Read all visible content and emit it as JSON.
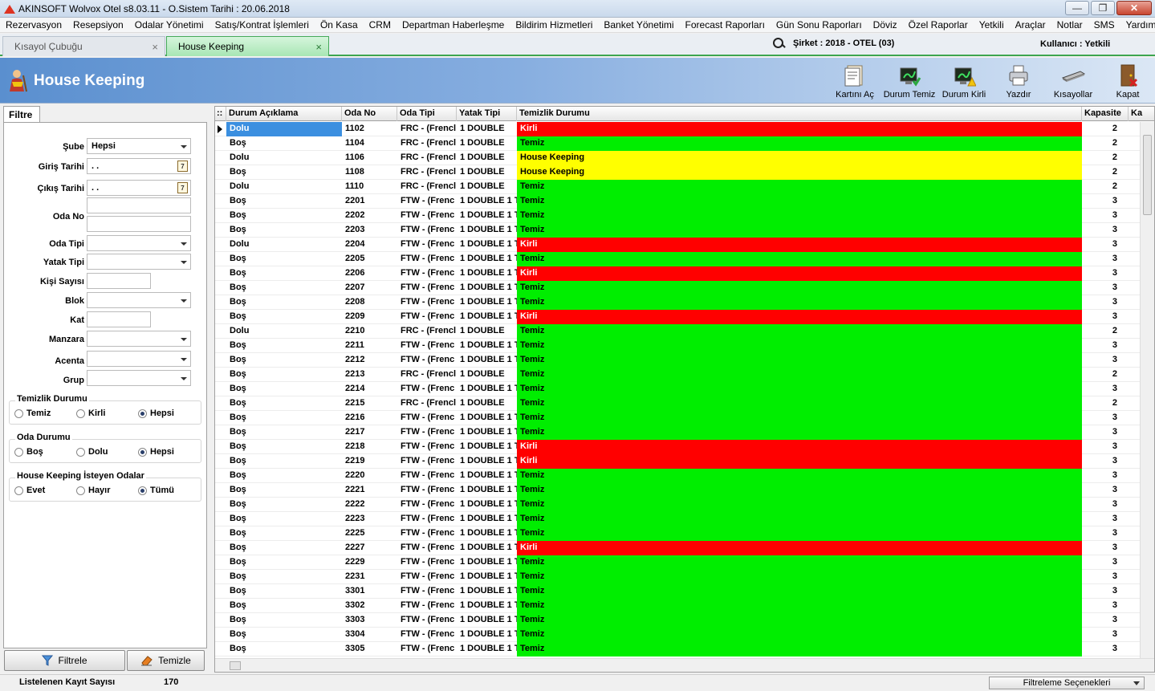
{
  "window": {
    "title": "AKINSOFT Wolvox Otel s8.03.11 - O.Sistem Tarihi : 20.06.2018",
    "minimize": "—",
    "restore": "❐",
    "close": "✕"
  },
  "menu": [
    "Rezervasyon",
    "Resepsiyon",
    "Odalar Yönetimi",
    "Satış/Kontrat İşlemleri",
    "Ön Kasa",
    "CRM",
    "Departman Haberleşme",
    "Bildirim Hizmetleri",
    "Banket Yönetimi",
    "Forecast Raporları",
    "Gün Sonu Raporları",
    "Döviz",
    "Özel Raporlar",
    "Yetkili",
    "Araçlar",
    "Notlar",
    "SMS",
    "Yardım"
  ],
  "tabs": [
    {
      "label": "Kısayol Çubuğu",
      "close": "×"
    },
    {
      "label": "House Keeping",
      "close": "×"
    }
  ],
  "company": "Şirket : 2018 - OTEL (03)",
  "user": "Kullanıcı : Yetkili",
  "header": {
    "title": "House Keeping"
  },
  "toolbar": [
    {
      "label": "Kartını Aç",
      "icon": "card-open-icon"
    },
    {
      "label": "Durum Temiz",
      "icon": "status-clean-icon"
    },
    {
      "label": "Durum Kirli",
      "icon": "status-dirty-icon"
    },
    {
      "label": "Yazdır",
      "icon": "printer-icon"
    },
    {
      "label": "Kısayollar",
      "icon": "shortcuts-icon"
    },
    {
      "label": "Kapat",
      "icon": "exit-door-icon"
    }
  ],
  "filter": {
    "tab": "Filtre",
    "sube_label": "Şube",
    "sube_value": "Hepsi",
    "giris_label": "Giriş Tarihi",
    "giris_value": ". .",
    "cikis_label": "Çıkış Tarihi",
    "cikis_value": ". .",
    "calendar_glyph": "7",
    "odano_label": "Oda No",
    "odatipi_label": "Oda Tipi",
    "yatak_label": "Yatak Tipi",
    "kisi_label": "Kişi Sayısı",
    "blok_label": "Blok",
    "kat_label": "Kat",
    "manzara_label": "Manzara",
    "acenta_label": "Acenta",
    "grup_label": "Grup",
    "temizlik": {
      "title": "Temizlik Durumu",
      "options": [
        "Temiz",
        "Kirli",
        "Hepsi"
      ],
      "selected": 2
    },
    "oda": {
      "title": "Oda Durumu",
      "options": [
        "Boş",
        "Dolu",
        "Hepsi"
      ],
      "selected": 2
    },
    "hk": {
      "title": "House Keeping İsteyen Odalar",
      "options": [
        "Evet",
        "Hayır",
        "Tümü"
      ],
      "selected": 2
    },
    "filter_button": "Filtrele",
    "clear_button": "Temizle"
  },
  "grid": {
    "columns": [
      "Durum Açıklama",
      "Oda No",
      "Oda Tipi",
      "Yatak Tipi",
      "Temizlik Durumu",
      "Kapasite",
      "Ka"
    ],
    "corner": "::",
    "status_colors": {
      "Kirli": "#ff0000",
      "Temiz": "#00ee00",
      "House Keeping": "#ffff00"
    },
    "rows": [
      [
        "Dolu",
        "1102",
        "FRC - (Frencl",
        "1 DOUBLE",
        "Kirli",
        "2"
      ],
      [
        "Boş",
        "1104",
        "FRC - (Frencl",
        "1 DOUBLE",
        "Temiz",
        "2"
      ],
      [
        "Dolu",
        "1106",
        "FRC - (Frencl",
        "1 DOUBLE",
        "House Keeping",
        "2"
      ],
      [
        "Boş",
        "1108",
        "FRC - (Frencl",
        "1 DOUBLE",
        "House Keeping",
        "2"
      ],
      [
        "Dolu",
        "1110",
        "FRC - (Frencl",
        "1 DOUBLE",
        "Temiz",
        "2"
      ],
      [
        "Boş",
        "2201",
        "FTW - (Frenc",
        "1 DOUBLE 1 T",
        "Temiz",
        "3"
      ],
      [
        "Boş",
        "2202",
        "FTW - (Frenc",
        "1 DOUBLE 1 T",
        "Temiz",
        "3"
      ],
      [
        "Boş",
        "2203",
        "FTW - (Frenc",
        "1 DOUBLE 1 T",
        "Temiz",
        "3"
      ],
      [
        "Dolu",
        "2204",
        "FTW - (Frenc",
        "1 DOUBLE 1 T",
        "Kirli",
        "3"
      ],
      [
        "Boş",
        "2205",
        "FTW - (Frenc",
        "1 DOUBLE 1 T",
        "Temiz",
        "3"
      ],
      [
        "Boş",
        "2206",
        "FTW - (Frenc",
        "1 DOUBLE 1 T",
        "Kirli",
        "3"
      ],
      [
        "Boş",
        "2207",
        "FTW - (Frenc",
        "1 DOUBLE 1 T",
        "Temiz",
        "3"
      ],
      [
        "Boş",
        "2208",
        "FTW - (Frenc",
        "1 DOUBLE 1 T",
        "Temiz",
        "3"
      ],
      [
        "Boş",
        "2209",
        "FTW - (Frenc",
        "1 DOUBLE 1 T",
        "Kirli",
        "3"
      ],
      [
        "Dolu",
        "2210",
        "FRC - (Frencl",
        "1 DOUBLE",
        "Temiz",
        "2"
      ],
      [
        "Boş",
        "2211",
        "FTW - (Frenc",
        "1 DOUBLE 1 T",
        "Temiz",
        "3"
      ],
      [
        "Boş",
        "2212",
        "FTW - (Frenc",
        "1 DOUBLE 1 T",
        "Temiz",
        "3"
      ],
      [
        "Boş",
        "2213",
        "FRC - (Frencl",
        "1 DOUBLE",
        "Temiz",
        "2"
      ],
      [
        "Boş",
        "2214",
        "FTW - (Frenc",
        "1 DOUBLE 1 T",
        "Temiz",
        "3"
      ],
      [
        "Boş",
        "2215",
        "FRC - (Frencl",
        "1 DOUBLE",
        "Temiz",
        "2"
      ],
      [
        "Boş",
        "2216",
        "FTW - (Frenc",
        "1 DOUBLE 1 T",
        "Temiz",
        "3"
      ],
      [
        "Boş",
        "2217",
        "FTW - (Frenc",
        "1 DOUBLE 1 T",
        "Temiz",
        "3"
      ],
      [
        "Boş",
        "2218",
        "FTW - (Frenc",
        "1 DOUBLE 1 T",
        "Kirli",
        "3"
      ],
      [
        "Boş",
        "2219",
        "FTW - (Frenc",
        "1 DOUBLE 1 T",
        "Kirli",
        "3"
      ],
      [
        "Boş",
        "2220",
        "FTW - (Frenc",
        "1 DOUBLE 1 T",
        "Temiz",
        "3"
      ],
      [
        "Boş",
        "2221",
        "FTW - (Frenc",
        "1 DOUBLE 1 T",
        "Temiz",
        "3"
      ],
      [
        "Boş",
        "2222",
        "FTW - (Frenc",
        "1 DOUBLE 1 T",
        "Temiz",
        "3"
      ],
      [
        "Boş",
        "2223",
        "FTW - (Frenc",
        "1 DOUBLE 1 T",
        "Temiz",
        "3"
      ],
      [
        "Boş",
        "2225",
        "FTW - (Frenc",
        "1 DOUBLE 1 T",
        "Temiz",
        "3"
      ],
      [
        "Boş",
        "2227",
        "FTW - (Frenc",
        "1 DOUBLE 1 T",
        "Kirli",
        "3"
      ],
      [
        "Boş",
        "2229",
        "FTW - (Frenc",
        "1 DOUBLE 1 T",
        "Temiz",
        "3"
      ],
      [
        "Boş",
        "2231",
        "FTW - (Frenc",
        "1 DOUBLE 1 T",
        "Temiz",
        "3"
      ],
      [
        "Boş",
        "3301",
        "FTW - (Frenc",
        "1 DOUBLE 1 T",
        "Temiz",
        "3"
      ],
      [
        "Boş",
        "3302",
        "FTW - (Frenc",
        "1 DOUBLE 1 T",
        "Temiz",
        "3"
      ],
      [
        "Boş",
        "3303",
        "FTW - (Frenc",
        "1 DOUBLE 1 T",
        "Temiz",
        "3"
      ],
      [
        "Boş",
        "3304",
        "FTW - (Frenc",
        "1 DOUBLE 1 T",
        "Temiz",
        "3"
      ],
      [
        "Boş",
        "3305",
        "FTW - (Frenc",
        "1 DOUBLE 1 T",
        "Temiz",
        "3"
      ]
    ],
    "selected_row": 0
  },
  "status": {
    "count_label": "Listelenen Kayıt Sayısı",
    "count_value": "170",
    "filter_options": "Filtreleme Seçenekleri"
  }
}
